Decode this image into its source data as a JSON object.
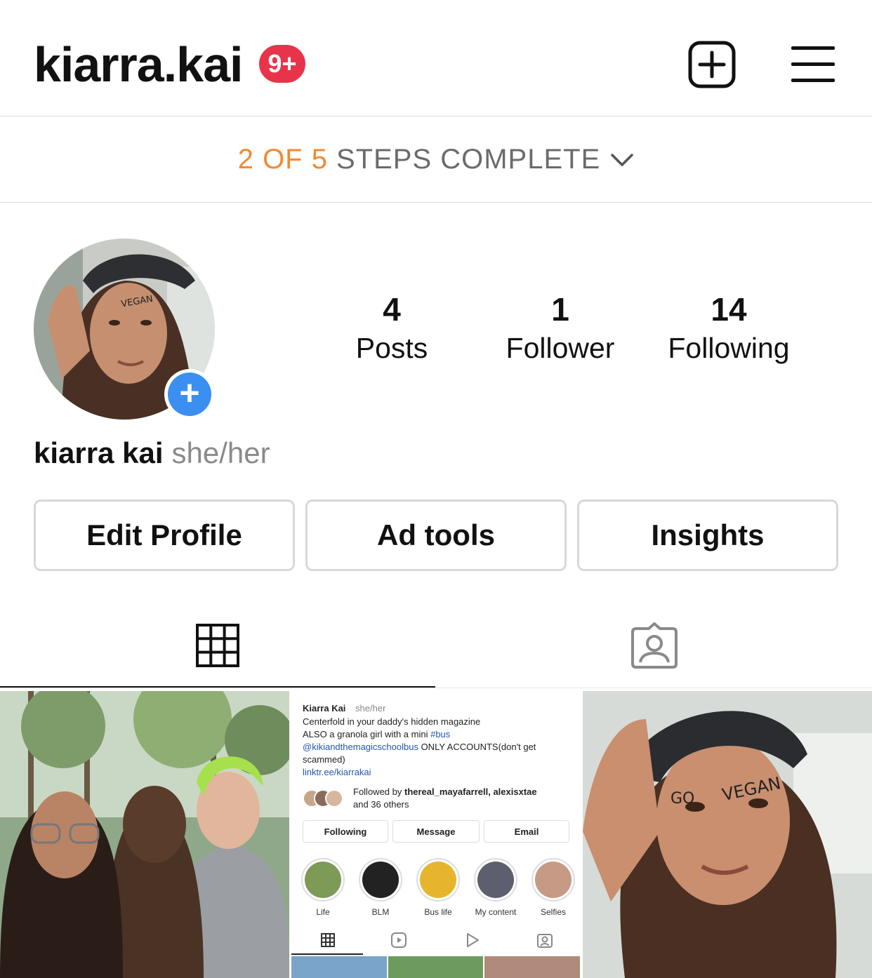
{
  "header": {
    "username": "kiarra.kai",
    "notification_badge": "9+",
    "new_post_icon": "plus-square-icon",
    "menu_icon": "hamburger-menu-icon"
  },
  "steps": {
    "done": "2 OF 5",
    "rest": "STEPS COMPLETE",
    "icon": "chevron-down-icon",
    "done_color": "#f08a32"
  },
  "profile": {
    "stats": [
      {
        "value": "4",
        "label": "Posts"
      },
      {
        "value": "1",
        "label": "Follower"
      },
      {
        "value": "14",
        "label": "Following"
      }
    ],
    "name": "kiarra kai",
    "pronouns": "she/her",
    "add_story_icon": "plus-circle-icon",
    "accent": "#3b8ff0"
  },
  "actions": {
    "edit_profile": "Edit Profile",
    "ad_tools": "Ad tools",
    "insights": "Insights"
  },
  "tabs": [
    {
      "icon": "grid-icon",
      "active": true
    },
    {
      "icon": "tagged-person-icon",
      "active": false
    }
  ],
  "posts": [
    {
      "type": "photo",
      "description_icon": "group-photo-with-dog"
    },
    {
      "type": "screenshot",
      "name_line": "Kiarra Kai",
      "pronouns": "she/her",
      "bio_1": "Centerfold in your daddy's hidden magazine",
      "bio_2": "ALSO a granola girl with a mini ",
      "bio_2_tag": "#bus",
      "bio_3_mention": "@kikiandthemagicschoolbus",
      "bio_3_rest": " ONLY ACCOUNTS(don't get",
      "bio_4": "scammed)",
      "link": "linktr.ee/kiarrakai",
      "followed_by_prefix": "Followed by ",
      "followed_by_names": "thereal_mayafarrell, alexisxtae",
      "followed_by_rest": "and 36 others",
      "buttons": [
        "Following",
        "Message",
        "Email"
      ],
      "highlights": [
        "Life",
        "BLM",
        "Bus life",
        "My content",
        "Selfies"
      ]
    },
    {
      "type": "photo",
      "description_icon": "selfie-go-vegan"
    }
  ]
}
